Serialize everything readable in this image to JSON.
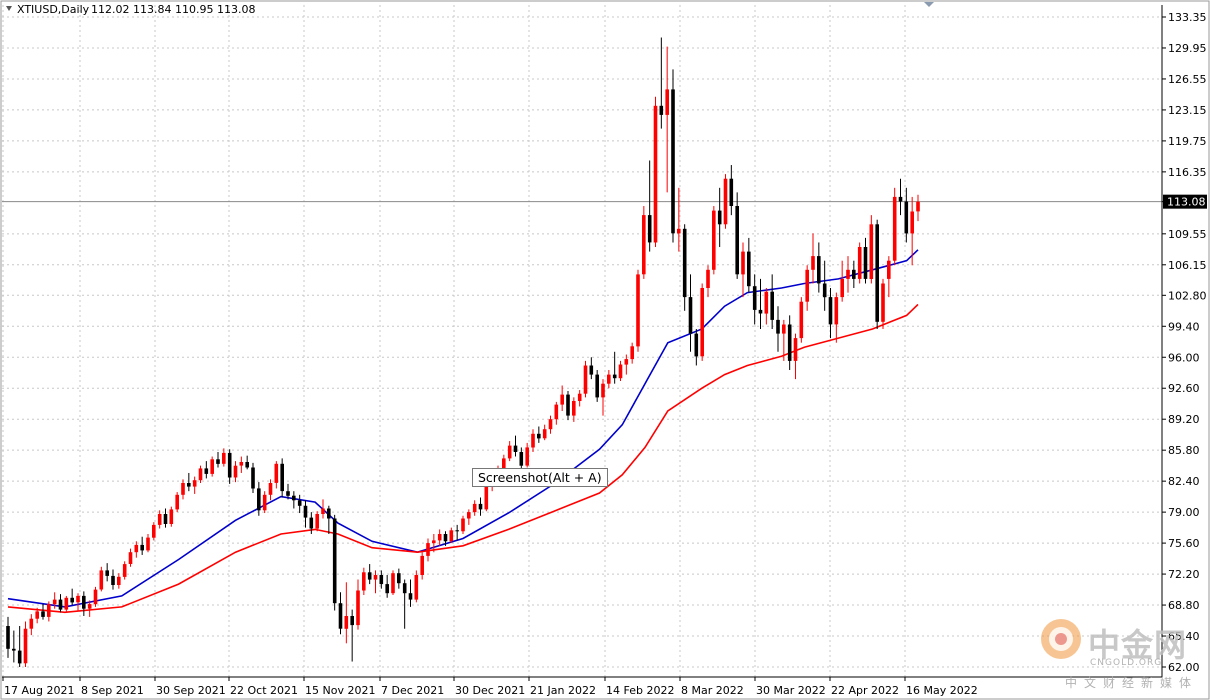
{
  "chart_data": {
    "type": "candlestick",
    "symbol": "XTIUSD,Daily",
    "ohlc_header": "112.02 113.84 110.95 113.08",
    "ylim": [
      62.0,
      135.0
    ],
    "y_ticks": [
      "133.35",
      "129.95",
      "126.55",
      "123.15",
      "119.75",
      "116.35",
      "113.08",
      "109.55",
      "106.15",
      "102.80",
      "99.40",
      "96.00",
      "92.60",
      "89.20",
      "85.80",
      "82.40",
      "79.00",
      "75.60",
      "72.20",
      "68.80",
      "65.40",
      "62.00"
    ],
    "current_price": "113.08",
    "x_tick_labels": [
      "17 Aug 2021",
      "8 Sep 2021",
      "30 Sep 2021",
      "22 Oct 2021",
      "15 Nov 2021",
      "7 Dec 2021",
      "30 Dec 2021",
      "21 Jan 2022",
      "14 Feb 2022",
      "8 Mar 2022",
      "30 Mar 2022",
      "22 Apr 2022",
      "16 May 2022"
    ],
    "bull_color": "#ff0000",
    "bear_color": "#000000",
    "candles": [
      {
        "o": 66.5,
        "h": 67.5,
        "l": 63.0,
        "c": 64.0
      },
      {
        "o": 64.0,
        "h": 66.0,
        "l": 62.5,
        "c": 63.8
      },
      {
        "o": 63.8,
        "h": 66.5,
        "l": 62.0,
        "c": 62.4
      },
      {
        "o": 62.4,
        "h": 67.0,
        "l": 62.0,
        "c": 66.2
      },
      {
        "o": 66.2,
        "h": 67.8,
        "l": 65.5,
        "c": 67.3
      },
      {
        "o": 67.3,
        "h": 68.5,
        "l": 66.8,
        "c": 68.1
      },
      {
        "o": 68.1,
        "h": 68.9,
        "l": 67.2,
        "c": 67.5
      },
      {
        "o": 67.5,
        "h": 69.2,
        "l": 67.0,
        "c": 68.9
      },
      {
        "o": 68.9,
        "h": 70.2,
        "l": 68.4,
        "c": 69.4
      },
      {
        "o": 69.4,
        "h": 70.0,
        "l": 68.0,
        "c": 68.3
      },
      {
        "o": 68.3,
        "h": 69.8,
        "l": 68.0,
        "c": 69.6
      },
      {
        "o": 69.6,
        "h": 70.6,
        "l": 68.8,
        "c": 69.1
      },
      {
        "o": 69.1,
        "h": 70.1,
        "l": 68.1,
        "c": 69.8
      },
      {
        "o": 69.8,
        "h": 70.3,
        "l": 67.6,
        "c": 68.4
      },
      {
        "o": 68.4,
        "h": 69.3,
        "l": 67.5,
        "c": 68.9
      },
      {
        "o": 68.9,
        "h": 70.8,
        "l": 68.6,
        "c": 70.5
      },
      {
        "o": 70.5,
        "h": 73.0,
        "l": 70.3,
        "c": 72.6
      },
      {
        "o": 72.6,
        "h": 73.4,
        "l": 71.4,
        "c": 72.0
      },
      {
        "o": 72.0,
        "h": 72.7,
        "l": 70.5,
        "c": 71.0
      },
      {
        "o": 71.0,
        "h": 72.3,
        "l": 70.6,
        "c": 71.9
      },
      {
        "o": 71.9,
        "h": 73.6,
        "l": 71.6,
        "c": 73.3
      },
      {
        "o": 73.3,
        "h": 75.0,
        "l": 73.0,
        "c": 74.6
      },
      {
        "o": 74.6,
        "h": 75.8,
        "l": 74.0,
        "c": 75.4
      },
      {
        "o": 75.4,
        "h": 76.3,
        "l": 74.3,
        "c": 74.8
      },
      {
        "o": 74.8,
        "h": 76.6,
        "l": 74.6,
        "c": 76.2
      },
      {
        "o": 76.2,
        "h": 77.9,
        "l": 75.9,
        "c": 77.6
      },
      {
        "o": 77.6,
        "h": 79.2,
        "l": 77.2,
        "c": 78.8
      },
      {
        "o": 78.8,
        "h": 79.4,
        "l": 77.3,
        "c": 77.7
      },
      {
        "o": 77.7,
        "h": 79.6,
        "l": 77.4,
        "c": 79.3
      },
      {
        "o": 79.3,
        "h": 81.2,
        "l": 79.0,
        "c": 80.9
      },
      {
        "o": 80.9,
        "h": 82.6,
        "l": 80.4,
        "c": 82.2
      },
      {
        "o": 82.2,
        "h": 83.3,
        "l": 81.3,
        "c": 81.8
      },
      {
        "o": 81.8,
        "h": 82.9,
        "l": 81.0,
        "c": 82.5
      },
      {
        "o": 82.5,
        "h": 84.1,
        "l": 82.2,
        "c": 83.8
      },
      {
        "o": 83.8,
        "h": 84.6,
        "l": 82.7,
        "c": 83.2
      },
      {
        "o": 83.2,
        "h": 85.1,
        "l": 82.9,
        "c": 84.8
      },
      {
        "o": 84.8,
        "h": 85.6,
        "l": 83.9,
        "c": 84.3
      },
      {
        "o": 84.3,
        "h": 86.0,
        "l": 84.0,
        "c": 85.5
      },
      {
        "o": 85.5,
        "h": 85.9,
        "l": 82.1,
        "c": 82.8
      },
      {
        "o": 82.8,
        "h": 84.6,
        "l": 82.3,
        "c": 84.1
      },
      {
        "o": 84.1,
        "h": 85.1,
        "l": 83.3,
        "c": 84.5
      },
      {
        "o": 84.5,
        "h": 85.2,
        "l": 83.7,
        "c": 83.9
      },
      {
        "o": 83.9,
        "h": 84.4,
        "l": 81.1,
        "c": 81.6
      },
      {
        "o": 81.6,
        "h": 82.3,
        "l": 78.6,
        "c": 79.2
      },
      {
        "o": 79.2,
        "h": 81.3,
        "l": 78.9,
        "c": 80.9
      },
      {
        "o": 80.9,
        "h": 82.6,
        "l": 80.3,
        "c": 82.2
      },
      {
        "o": 82.2,
        "h": 84.6,
        "l": 81.6,
        "c": 84.3
      },
      {
        "o": 84.3,
        "h": 84.9,
        "l": 80.6,
        "c": 81.3
      },
      {
        "o": 81.3,
        "h": 82.1,
        "l": 80.4,
        "c": 80.8
      },
      {
        "o": 80.8,
        "h": 81.3,
        "l": 79.4,
        "c": 80.3
      },
      {
        "o": 80.3,
        "h": 80.9,
        "l": 78.9,
        "c": 79.7
      },
      {
        "o": 79.7,
        "h": 80.3,
        "l": 77.3,
        "c": 78.4
      },
      {
        "o": 78.4,
        "h": 79.0,
        "l": 76.6,
        "c": 77.2
      },
      {
        "o": 77.2,
        "h": 79.1,
        "l": 76.9,
        "c": 78.8
      },
      {
        "o": 78.8,
        "h": 80.4,
        "l": 78.3,
        "c": 79.4
      },
      {
        "o": 79.4,
        "h": 79.7,
        "l": 76.6,
        "c": 78.3
      },
      {
        "o": 78.3,
        "h": 78.7,
        "l": 68.2,
        "c": 69.0
      },
      {
        "o": 69.0,
        "h": 70.2,
        "l": 65.6,
        "c": 66.2
      },
      {
        "o": 66.2,
        "h": 71.3,
        "l": 64.6,
        "c": 67.6
      },
      {
        "o": 67.6,
        "h": 68.3,
        "l": 62.6,
        "c": 66.6
      },
      {
        "o": 66.6,
        "h": 71.6,
        "l": 66.1,
        "c": 70.4
      },
      {
        "o": 70.4,
        "h": 72.9,
        "l": 69.9,
        "c": 72.4
      },
      {
        "o": 72.4,
        "h": 73.3,
        "l": 71.1,
        "c": 71.6
      },
      {
        "o": 71.6,
        "h": 72.6,
        "l": 70.1,
        "c": 72.1
      },
      {
        "o": 72.1,
        "h": 72.6,
        "l": 70.6,
        "c": 71.1
      },
      {
        "o": 71.1,
        "h": 72.1,
        "l": 69.6,
        "c": 70.1
      },
      {
        "o": 70.1,
        "h": 72.6,
        "l": 69.9,
        "c": 72.3
      },
      {
        "o": 72.3,
        "h": 72.8,
        "l": 70.6,
        "c": 71.2
      },
      {
        "o": 71.2,
        "h": 71.6,
        "l": 66.2,
        "c": 70.1
      },
      {
        "o": 70.1,
        "h": 71.6,
        "l": 68.6,
        "c": 69.4
      },
      {
        "o": 69.4,
        "h": 72.6,
        "l": 69.1,
        "c": 72.1
      },
      {
        "o": 72.1,
        "h": 74.6,
        "l": 71.6,
        "c": 74.2
      },
      {
        "o": 74.2,
        "h": 76.1,
        "l": 73.6,
        "c": 75.6
      },
      {
        "o": 75.6,
        "h": 76.6,
        "l": 74.6,
        "c": 75.9
      },
      {
        "o": 75.9,
        "h": 77.1,
        "l": 75.3,
        "c": 76.6
      },
      {
        "o": 76.6,
        "h": 76.9,
        "l": 75.3,
        "c": 75.8
      },
      {
        "o": 75.8,
        "h": 77.3,
        "l": 75.6,
        "c": 77.0
      },
      {
        "o": 77.0,
        "h": 77.6,
        "l": 75.9,
        "c": 76.9
      },
      {
        "o": 76.9,
        "h": 78.6,
        "l": 76.6,
        "c": 78.3
      },
      {
        "o": 78.3,
        "h": 79.3,
        "l": 77.6,
        "c": 79.0
      },
      {
        "o": 79.0,
        "h": 80.3,
        "l": 78.6,
        "c": 79.9
      },
      {
        "o": 79.9,
        "h": 80.6,
        "l": 78.6,
        "c": 79.3
      },
      {
        "o": 79.3,
        "h": 82.1,
        "l": 79.1,
        "c": 81.8
      },
      {
        "o": 81.8,
        "h": 83.1,
        "l": 81.3,
        "c": 82.6
      },
      {
        "o": 82.6,
        "h": 84.1,
        "l": 82.1,
        "c": 83.8
      },
      {
        "o": 83.8,
        "h": 85.3,
        "l": 83.3,
        "c": 84.9
      },
      {
        "o": 84.9,
        "h": 86.8,
        "l": 84.6,
        "c": 86.3
      },
      {
        "o": 86.3,
        "h": 87.4,
        "l": 85.1,
        "c": 85.6
      },
      {
        "o": 85.6,
        "h": 86.1,
        "l": 83.6,
        "c": 84.1
      },
      {
        "o": 84.1,
        "h": 86.6,
        "l": 83.9,
        "c": 86.1
      },
      {
        "o": 86.1,
        "h": 88.1,
        "l": 85.6,
        "c": 87.6
      },
      {
        "o": 87.6,
        "h": 88.4,
        "l": 86.6,
        "c": 87.1
      },
      {
        "o": 87.1,
        "h": 88.6,
        "l": 86.9,
        "c": 88.1
      },
      {
        "o": 88.1,
        "h": 89.6,
        "l": 87.6,
        "c": 89.2
      },
      {
        "o": 89.2,
        "h": 91.1,
        "l": 88.6,
        "c": 90.8
      },
      {
        "o": 90.8,
        "h": 92.9,
        "l": 90.1,
        "c": 91.9
      },
      {
        "o": 91.9,
        "h": 92.3,
        "l": 89.1,
        "c": 89.6
      },
      {
        "o": 89.6,
        "h": 91.6,
        "l": 88.9,
        "c": 91.2
      },
      {
        "o": 91.2,
        "h": 92.4,
        "l": 90.6,
        "c": 92.0
      },
      {
        "o": 92.0,
        "h": 95.6,
        "l": 91.6,
        "c": 95.1
      },
      {
        "o": 95.1,
        "h": 96.0,
        "l": 93.6,
        "c": 94.1
      },
      {
        "o": 94.1,
        "h": 94.6,
        "l": 91.1,
        "c": 91.6
      },
      {
        "o": 91.6,
        "h": 93.6,
        "l": 89.6,
        "c": 93.1
      },
      {
        "o": 93.1,
        "h": 94.6,
        "l": 92.6,
        "c": 94.1
      },
      {
        "o": 94.1,
        "h": 96.6,
        "l": 93.1,
        "c": 93.7
      },
      {
        "o": 93.7,
        "h": 95.6,
        "l": 93.4,
        "c": 95.2
      },
      {
        "o": 95.2,
        "h": 96.3,
        "l": 94.1,
        "c": 95.8
      },
      {
        "o": 95.8,
        "h": 97.6,
        "l": 95.3,
        "c": 97.2
      },
      {
        "o": 97.2,
        "h": 105.6,
        "l": 96.6,
        "c": 105.1
      },
      {
        "o": 105.1,
        "h": 112.6,
        "l": 104.6,
        "c": 111.6
      },
      {
        "o": 111.6,
        "h": 117.6,
        "l": 107.6,
        "c": 108.6
      },
      {
        "o": 108.6,
        "h": 124.6,
        "l": 108.1,
        "c": 123.6
      },
      {
        "o": 123.6,
        "h": 131.1,
        "l": 121.1,
        "c": 122.6
      },
      {
        "o": 122.6,
        "h": 130.1,
        "l": 114.1,
        "c": 125.4
      },
      {
        "o": 125.4,
        "h": 127.6,
        "l": 108.6,
        "c": 109.6
      },
      {
        "o": 109.6,
        "h": 114.6,
        "l": 107.6,
        "c": 110.1
      },
      {
        "o": 110.1,
        "h": 110.6,
        "l": 101.1,
        "c": 102.6
      },
      {
        "o": 102.6,
        "h": 105.1,
        "l": 96.6,
        "c": 98.6
      },
      {
        "o": 98.6,
        "h": 99.1,
        "l": 95.1,
        "c": 96.1
      },
      {
        "o": 96.1,
        "h": 104.1,
        "l": 95.6,
        "c": 103.6
      },
      {
        "o": 103.6,
        "h": 106.1,
        "l": 102.6,
        "c": 105.6
      },
      {
        "o": 105.6,
        "h": 112.6,
        "l": 105.1,
        "c": 112.1
      },
      {
        "o": 112.1,
        "h": 114.6,
        "l": 108.1,
        "c": 110.6
      },
      {
        "o": 110.6,
        "h": 116.1,
        "l": 110.1,
        "c": 115.6
      },
      {
        "o": 115.6,
        "h": 117.1,
        "l": 111.6,
        "c": 112.6
      },
      {
        "o": 112.6,
        "h": 114.1,
        "l": 104.6,
        "c": 105.1
      },
      {
        "o": 105.1,
        "h": 108.6,
        "l": 102.6,
        "c": 107.6
      },
      {
        "o": 107.6,
        "h": 109.1,
        "l": 103.1,
        "c": 103.8
      },
      {
        "o": 103.8,
        "h": 105.1,
        "l": 99.6,
        "c": 101.2
      },
      {
        "o": 101.2,
        "h": 104.6,
        "l": 99.1,
        "c": 100.8
      },
      {
        "o": 100.8,
        "h": 103.6,
        "l": 99.6,
        "c": 103.2
      },
      {
        "o": 103.2,
        "h": 105.1,
        "l": 99.1,
        "c": 100.1
      },
      {
        "o": 100.1,
        "h": 101.6,
        "l": 96.6,
        "c": 98.6
      },
      {
        "o": 98.6,
        "h": 100.1,
        "l": 95.6,
        "c": 99.6
      },
      {
        "o": 99.6,
        "h": 100.6,
        "l": 94.6,
        "c": 95.6
      },
      {
        "o": 95.6,
        "h": 98.6,
        "l": 93.6,
        "c": 98.1
      },
      {
        "o": 98.1,
        "h": 102.6,
        "l": 97.6,
        "c": 102.1
      },
      {
        "o": 102.1,
        "h": 106.1,
        "l": 101.1,
        "c": 105.6
      },
      {
        "o": 105.6,
        "h": 109.6,
        "l": 104.1,
        "c": 107.1
      },
      {
        "o": 107.1,
        "h": 108.6,
        "l": 103.1,
        "c": 104.1
      },
      {
        "o": 104.1,
        "h": 106.6,
        "l": 101.1,
        "c": 102.6
      },
      {
        "o": 102.6,
        "h": 103.6,
        "l": 98.1,
        "c": 99.6
      },
      {
        "o": 99.6,
        "h": 103.1,
        "l": 97.6,
        "c": 102.6
      },
      {
        "o": 102.6,
        "h": 106.6,
        "l": 102.1,
        "c": 104.6
      },
      {
        "o": 104.6,
        "h": 107.1,
        "l": 103.1,
        "c": 105.6
      },
      {
        "o": 105.6,
        "h": 106.6,
        "l": 103.6,
        "c": 104.6
      },
      {
        "o": 104.6,
        "h": 108.6,
        "l": 104.1,
        "c": 108.1
      },
      {
        "o": 108.1,
        "h": 109.1,
        "l": 104.1,
        "c": 104.6
      },
      {
        "o": 104.6,
        "h": 111.6,
        "l": 104.1,
        "c": 110.6
      },
      {
        "o": 110.6,
        "h": 111.1,
        "l": 99.1,
        "c": 99.9
      },
      {
        "o": 99.9,
        "h": 104.6,
        "l": 99.1,
        "c": 104.1
      },
      {
        "o": 104.6,
        "h": 107.1,
        "l": 102.6,
        "c": 106.6
      },
      {
        "o": 106.6,
        "h": 114.6,
        "l": 106.1,
        "c": 113.6
      },
      {
        "o": 113.6,
        "h": 115.6,
        "l": 111.6,
        "c": 113.1
      },
      {
        "o": 113.1,
        "h": 114.6,
        "l": 108.6,
        "c": 109.6
      },
      {
        "o": 109.6,
        "h": 113.6,
        "l": 106.1,
        "c": 112.0
      },
      {
        "o": 112.02,
        "h": 113.84,
        "l": 110.95,
        "c": 113.08
      }
    ],
    "moving_averages": [
      {
        "color": "#0000cc",
        "points": [
          [
            0,
            69.5
          ],
          [
            10,
            68.6
          ],
          [
            20,
            69.8
          ],
          [
            30,
            73.8
          ],
          [
            40,
            78.1
          ],
          [
            48,
            80.7
          ],
          [
            54,
            80.1
          ],
          [
            58,
            77.8
          ],
          [
            64,
            75.8
          ],
          [
            72,
            74.6
          ],
          [
            80,
            76.1
          ],
          [
            88,
            78.9
          ],
          [
            96,
            82.1
          ],
          [
            104,
            85.9
          ],
          [
            108,
            88.6
          ],
          [
            112,
            93.1
          ],
          [
            116,
            97.6
          ],
          [
            122,
            99.1
          ],
          [
            126,
            101.6
          ],
          [
            130,
            103.1
          ],
          [
            136,
            103.6
          ],
          [
            140,
            104.1
          ],
          [
            146,
            104.6
          ],
          [
            152,
            105.6
          ],
          [
            158,
            106.6
          ],
          [
            160,
            107.8
          ]
        ]
      },
      {
        "color": "#ff0000",
        "points": [
          [
            0,
            68.6
          ],
          [
            10,
            68.0
          ],
          [
            20,
            68.6
          ],
          [
            30,
            71.1
          ],
          [
            40,
            74.6
          ],
          [
            48,
            76.6
          ],
          [
            54,
            77.1
          ],
          [
            58,
            76.6
          ],
          [
            64,
            75.1
          ],
          [
            72,
            74.6
          ],
          [
            80,
            75.3
          ],
          [
            88,
            77.1
          ],
          [
            96,
            79.1
          ],
          [
            104,
            81.1
          ],
          [
            108,
            83.1
          ],
          [
            112,
            86.1
          ],
          [
            116,
            90.1
          ],
          [
            122,
            92.6
          ],
          [
            126,
            94.1
          ],
          [
            130,
            95.1
          ],
          [
            136,
            96.1
          ],
          [
            140,
            97.1
          ],
          [
            146,
            98.1
          ],
          [
            152,
            99.1
          ],
          [
            158,
            100.6
          ],
          [
            160,
            101.8
          ]
        ]
      }
    ]
  },
  "tooltip": "Screenshot(Alt + A)",
  "watermark": {
    "main": "中金网",
    "sub": "CNGOLD.ORG",
    "cn": "中文财经新媒体"
  }
}
